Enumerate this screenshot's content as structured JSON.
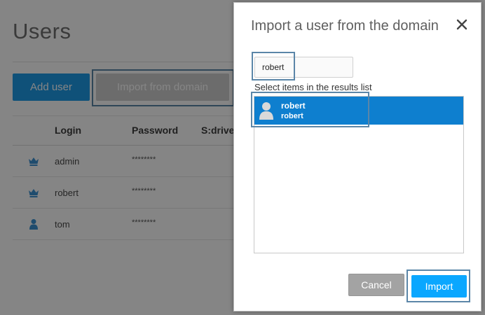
{
  "page": {
    "title": "Users",
    "add_user_label": "Add user",
    "import_from_domain_label": "Import from domain"
  },
  "table": {
    "columns": [
      "Login",
      "Password",
      "S:drive"
    ],
    "rows": [
      {
        "icon": "crown-icon",
        "login": "admin",
        "password": "********"
      },
      {
        "icon": "crown-icon",
        "login": "robert",
        "password": "********"
      },
      {
        "icon": "user-icon",
        "login": "tom",
        "password": "********"
      }
    ]
  },
  "dialog": {
    "title": "Import a user from the domain",
    "close_icon": "close-icon",
    "search_value": "robert",
    "results_label": "Select items in the results list",
    "results": [
      {
        "name": "robert",
        "sub": "robert",
        "icon": "user-avatar-icon",
        "selected": true
      }
    ],
    "cancel_label": "Cancel",
    "import_label": "Import"
  },
  "colors": {
    "primary_blue": "#1d9be8",
    "import_blue": "#0aa7ff",
    "selected_row": "#0e7fcf",
    "highlight_box": "#5b86a8",
    "cancel_gray": "#a3a3a3"
  }
}
